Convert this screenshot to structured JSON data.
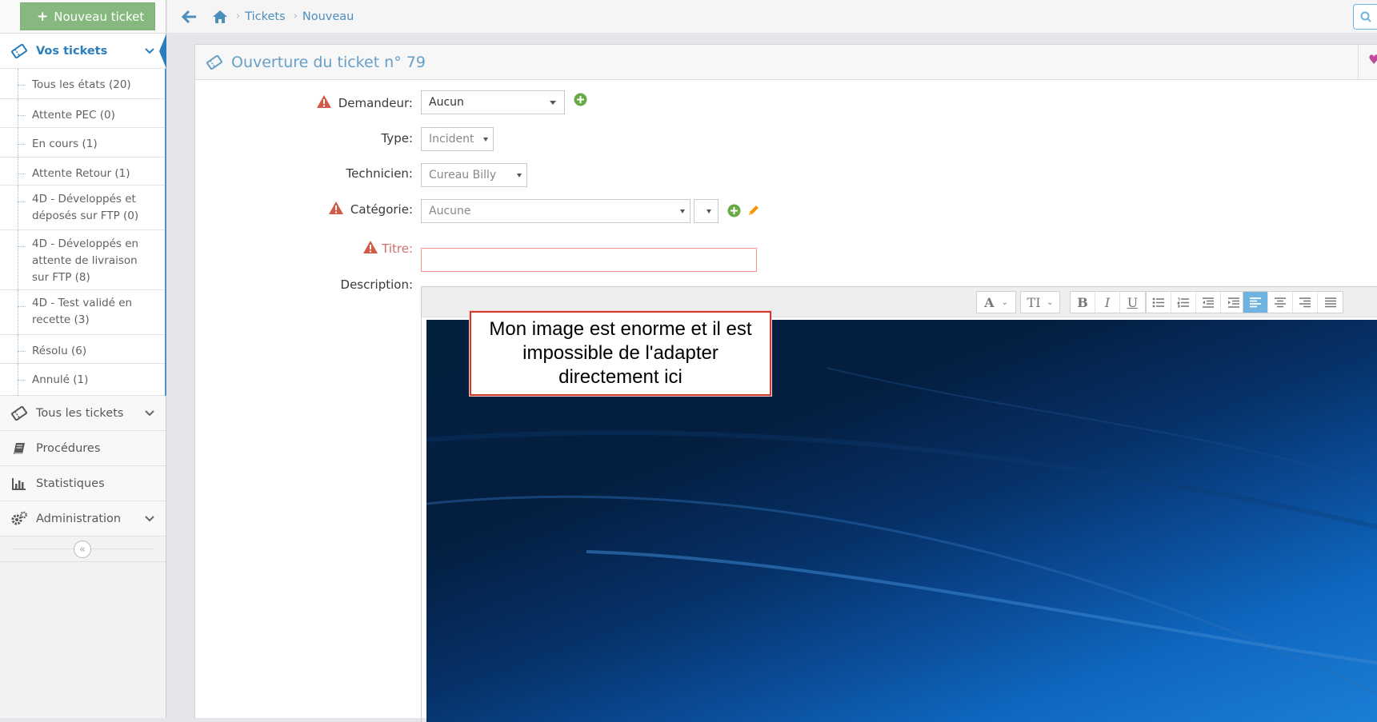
{
  "sidebar": {
    "new_ticket_label": "Nouveau ticket",
    "active_section": "Vos tickets",
    "subitems": [
      "Tous les états (20)",
      "Attente PEC (0)",
      "En cours (1)",
      "Attente Retour (1)",
      "4D - Développés et déposés sur FTP (0)",
      "4D - Développés en attente de livraison sur FTP (8)",
      "4D - Test validé en recette (3)",
      "Résolu (6)",
      "Annulé (1)"
    ],
    "sections": [
      "Tous les tickets",
      "Procédures",
      "Statistiques",
      "Administration"
    ]
  },
  "breadcrumbs": [
    "Tickets",
    "Nouveau"
  ],
  "widget": {
    "title": "Ouverture du ticket n° 79"
  },
  "form": {
    "requester_label": "Demandeur:",
    "requester_value": "Aucun",
    "type_label": "Type:",
    "type_value": "Incident",
    "technician_label": "Technicien:",
    "technician_value": "Cureau Billy",
    "category_label": "Catégorie:",
    "category_value": "Aucune",
    "title_label": "Titre:",
    "title_value": "",
    "description_label": "Description:"
  },
  "editor": {
    "annotation": "Mon image est enorme et il est impossible de l'adapter directement ici"
  },
  "colors": {
    "accent": "#2b7dbc",
    "success": "#87b87f",
    "danger": "#d15b47",
    "warning": "#f89406"
  }
}
